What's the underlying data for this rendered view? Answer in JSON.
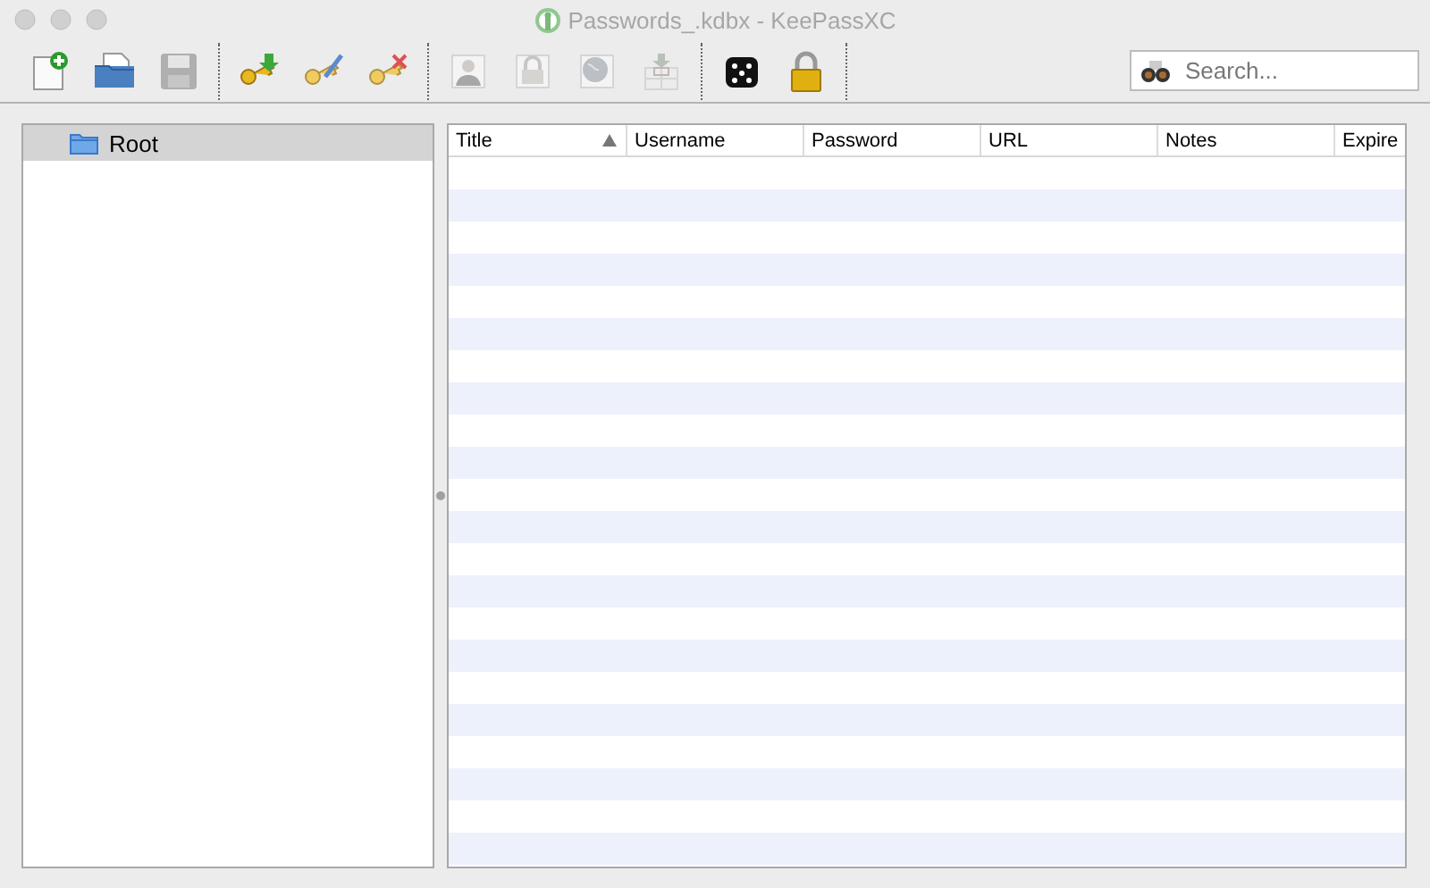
{
  "window": {
    "title": "Passwords_.kdbx - KeePassXC"
  },
  "toolbar": {
    "groups": [
      [
        {
          "kind": "new-db",
          "disabled": false
        },
        {
          "kind": "open-db",
          "disabled": false
        },
        {
          "kind": "save-db",
          "disabled": true
        }
      ],
      [
        {
          "kind": "add-entry",
          "disabled": false
        },
        {
          "kind": "edit-entry",
          "disabled": false
        },
        {
          "kind": "delete-entry",
          "disabled": false
        }
      ],
      [
        {
          "kind": "copy-user",
          "disabled": true
        },
        {
          "kind": "copy-pass",
          "disabled": true
        },
        {
          "kind": "open-url",
          "disabled": true
        },
        {
          "kind": "autotype",
          "disabled": true
        }
      ],
      [
        {
          "kind": "dice",
          "disabled": false
        },
        {
          "kind": "lock",
          "disabled": false
        }
      ]
    ],
    "search": {
      "placeholder": "Search..."
    }
  },
  "groups_tree": {
    "items": [
      {
        "label": "Root",
        "selected": true
      }
    ]
  },
  "table": {
    "columns": [
      {
        "label": "Title",
        "sorted": true
      },
      {
        "label": "Username",
        "sorted": false
      },
      {
        "label": "Password",
        "sorted": false
      },
      {
        "label": "URL",
        "sorted": false
      },
      {
        "label": "Notes",
        "sorted": false
      },
      {
        "label": "Expire",
        "sorted": false
      }
    ]
  }
}
